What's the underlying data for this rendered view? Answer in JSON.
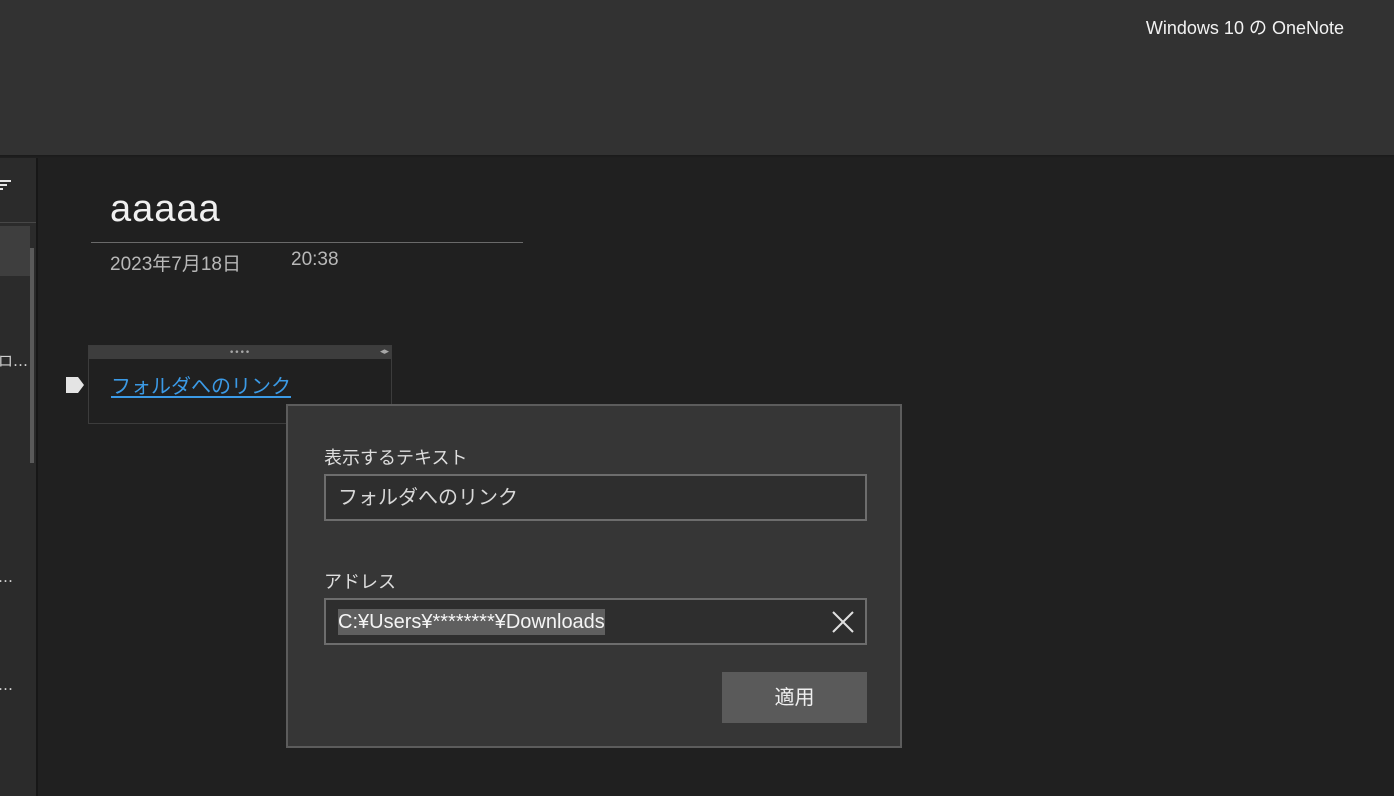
{
  "app": {
    "title": "Windows 10 の OneNote"
  },
  "sidebar": {
    "truncated_items": [
      "…",
      "…",
      "…"
    ],
    "truncated_first_char": "ロ…"
  },
  "page": {
    "title": "aaaaa",
    "date": "2023年7月18日",
    "time": "20:38"
  },
  "note": {
    "link_text": "フォルダへのリンク",
    "handle_grip": "••••",
    "handle_arrows": "◂▸"
  },
  "link_dialog": {
    "display_text_label": "表示するテキスト",
    "display_text_value": "フォルダへのリンク",
    "address_label": "アドレス",
    "address_value": "C:¥Users¥********¥Downloads",
    "apply_label": "適用"
  },
  "colors": {
    "link": "#3b9ae6",
    "background": "#202020",
    "topbar": "#323232",
    "dialog": "#363636"
  },
  "icons": {
    "sort": "sort-icon",
    "clear": "close-icon",
    "note_tag": "tag-icon"
  }
}
